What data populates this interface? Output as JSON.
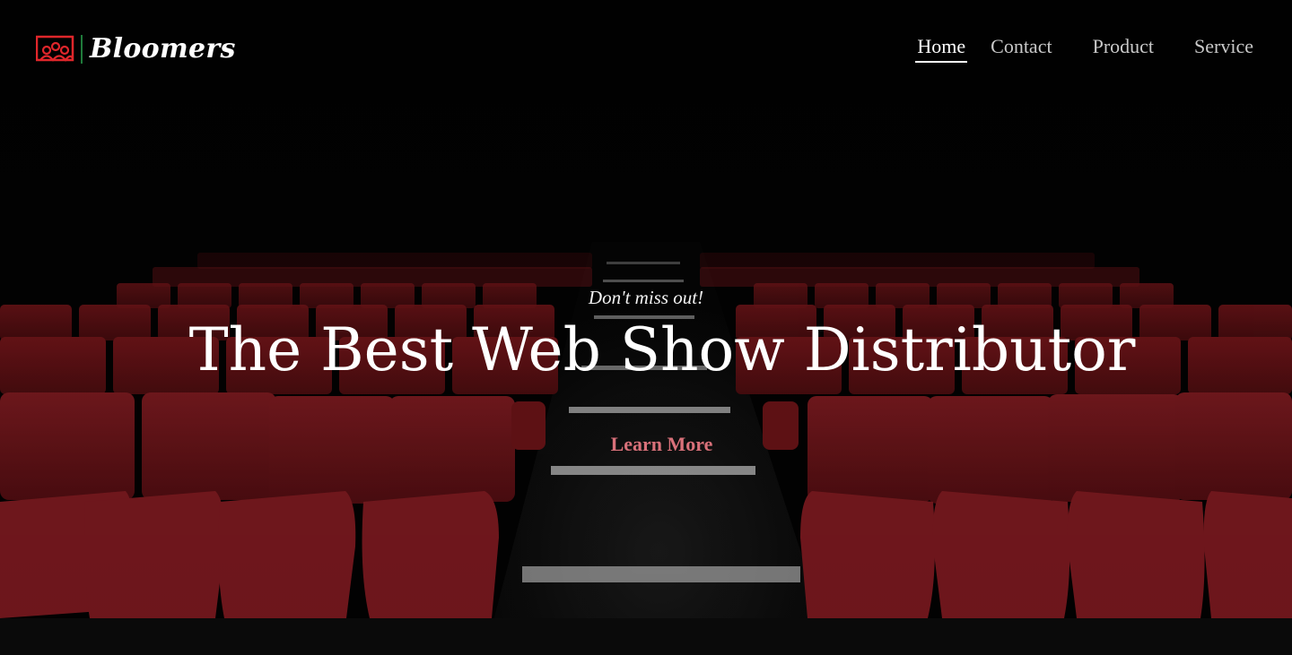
{
  "brand": {
    "name": "Bloomers",
    "accent_color": "#e0262b",
    "divider_color": "#1f7a3a",
    "icon": "audience-icon"
  },
  "nav": {
    "items": [
      {
        "label": "Home",
        "active": true
      },
      {
        "label": "Contact",
        "active": false
      },
      {
        "label": "Product",
        "active": false
      },
      {
        "label": "Service",
        "active": false
      }
    ]
  },
  "hero": {
    "tagline": "Don't miss out!",
    "headline": "The Best Web Show Distributor",
    "cta_label": "Learn More",
    "cta_color": "#d9717a",
    "background_description_icon": "theater-seats-image"
  }
}
